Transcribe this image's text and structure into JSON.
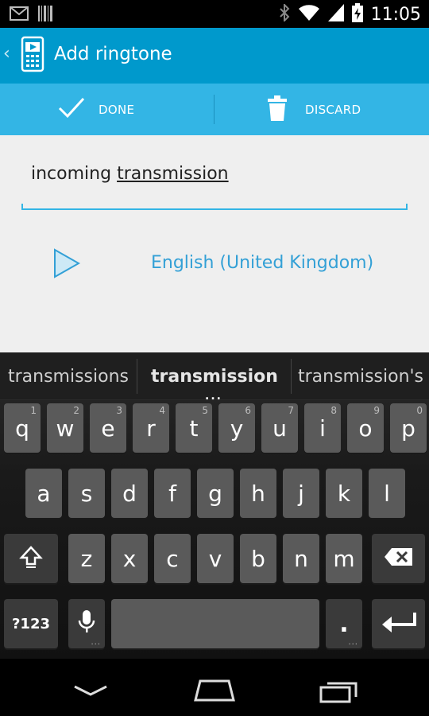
{
  "status_bar": {
    "time": "11:05",
    "icons": [
      "gmail-icon",
      "barcode-icon",
      "bluetooth-icon",
      "wifi-icon",
      "signal-icon",
      "battery-charging-icon"
    ]
  },
  "action_bar": {
    "title": "Add ringtone",
    "icon": "ringtone-phone-icon",
    "back_icon": "back-chevron-icon"
  },
  "done_discard": {
    "done_label": "DONE",
    "discard_label": "DISCARD"
  },
  "form": {
    "text_prefix": "incoming ",
    "text_composing": "transmission",
    "language": "English (United Kingdom)"
  },
  "keyboard": {
    "suggestions": [
      "transmissions",
      "transmission",
      "transmission's"
    ],
    "more_indicator": "...",
    "row1": [
      {
        "ch": "q",
        "hint": "1"
      },
      {
        "ch": "w",
        "hint": "2"
      },
      {
        "ch": "e",
        "hint": "3"
      },
      {
        "ch": "r",
        "hint": "4"
      },
      {
        "ch": "t",
        "hint": "5"
      },
      {
        "ch": "y",
        "hint": "6"
      },
      {
        "ch": "u",
        "hint": "7"
      },
      {
        "ch": "i",
        "hint": "8"
      },
      {
        "ch": "o",
        "hint": "9"
      },
      {
        "ch": "p",
        "hint": "0"
      }
    ],
    "row2": [
      "a",
      "s",
      "d",
      "f",
      "g",
      "h",
      "j",
      "k",
      "l"
    ],
    "row3": [
      "z",
      "x",
      "c",
      "v",
      "b",
      "n",
      "m"
    ],
    "symbols_label": "?123",
    "period_label": ".",
    "key_dots": "..."
  },
  "colors": {
    "action_bar": "#0099cc",
    "done_bar": "#33b5e5",
    "accent_text": "#33a0d6"
  }
}
